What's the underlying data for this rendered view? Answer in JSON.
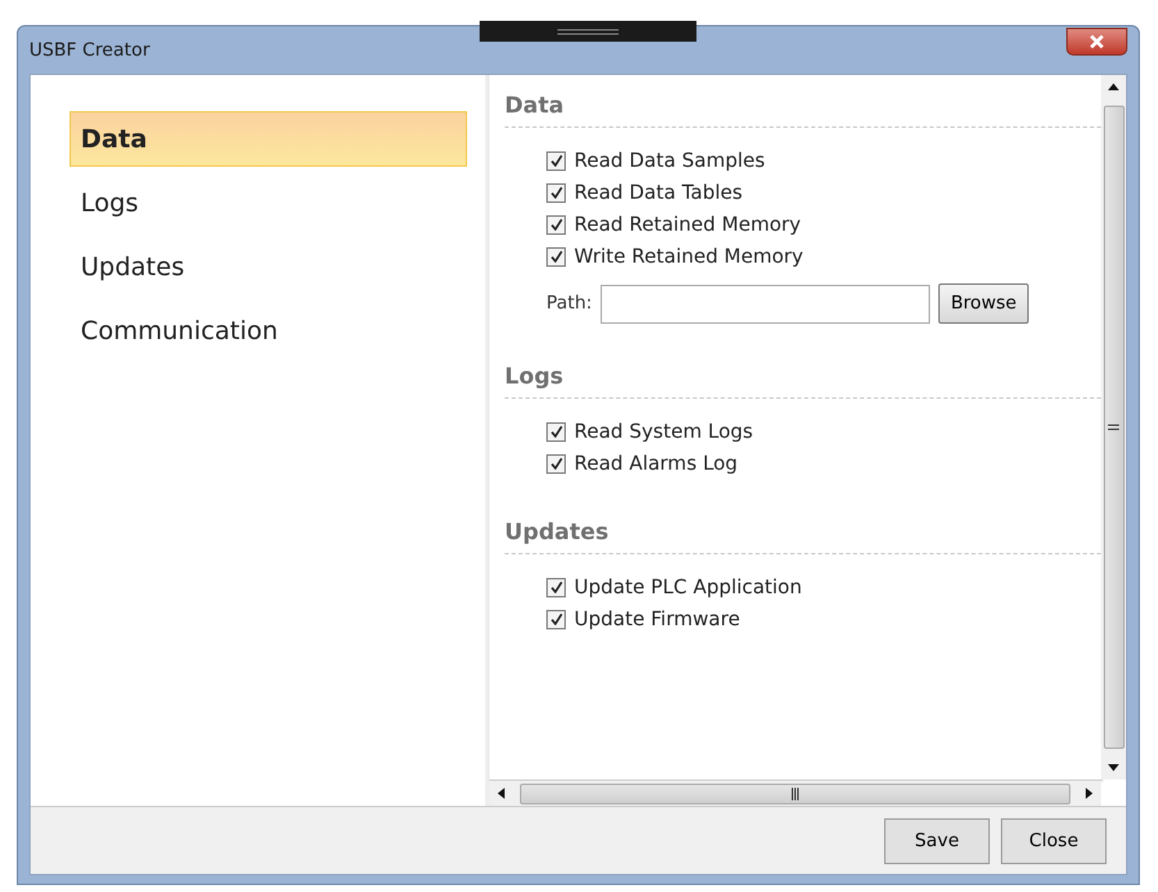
{
  "window": {
    "title": "USBF Creator"
  },
  "sidebar": {
    "items": [
      {
        "label": "Data",
        "selected": true
      },
      {
        "label": "Logs",
        "selected": false
      },
      {
        "label": "Updates",
        "selected": false
      },
      {
        "label": "Communication",
        "selected": false
      }
    ]
  },
  "sections": [
    {
      "heading": "Data",
      "options": [
        {
          "label": "Read Data Samples",
          "checked": true
        },
        {
          "label": "Read Data Tables",
          "checked": true
        },
        {
          "label": "Read Retained Memory",
          "checked": true
        },
        {
          "label": "Write Retained Memory",
          "checked": true
        }
      ],
      "path": {
        "label": "Path:",
        "button": "Browse"
      }
    },
    {
      "heading": "Logs",
      "options": [
        {
          "label": "Read System Logs",
          "checked": true
        },
        {
          "label": "Read Alarms Log",
          "checked": true
        }
      ]
    },
    {
      "heading": "Updates",
      "options": [
        {
          "label": "Update PLC Application",
          "checked": true
        },
        {
          "label": "Update Firmware",
          "checked": true
        }
      ]
    }
  ],
  "buttons": [
    "Save",
    "Close"
  ]
}
